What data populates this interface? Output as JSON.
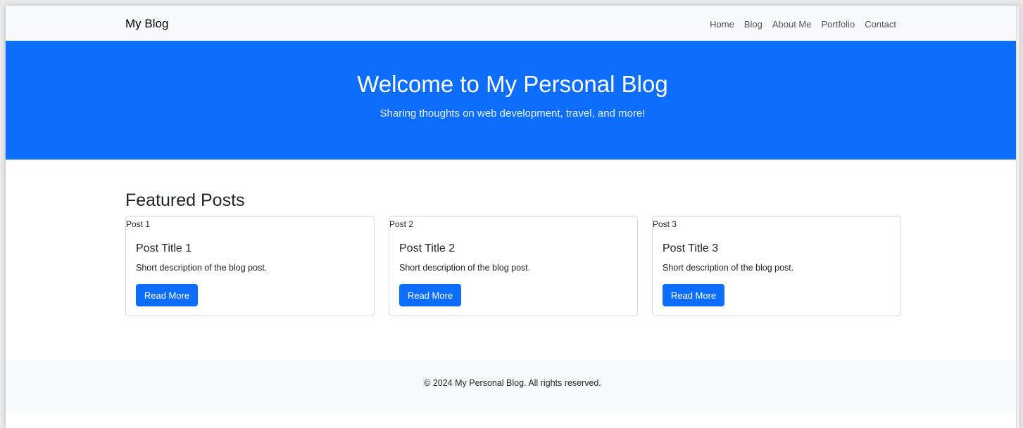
{
  "navbar": {
    "brand": "My Blog",
    "links": [
      "Home",
      "Blog",
      "About Me",
      "Portfolio",
      "Contact"
    ]
  },
  "hero": {
    "title": "Welcome to My Personal Blog",
    "subtitle": "Sharing thoughts on web development, travel, and more!"
  },
  "featured": {
    "heading": "Featured Posts",
    "posts": [
      {
        "image_alt": "Post 1",
        "title": "Post Title 1",
        "description": "Short description of the blog post.",
        "button": "Read More"
      },
      {
        "image_alt": "Post 2",
        "title": "Post Title 2",
        "description": "Short description of the blog post.",
        "button": "Read More"
      },
      {
        "image_alt": "Post 3",
        "title": "Post Title 3",
        "description": "Short description of the blog post.",
        "button": "Read More"
      }
    ]
  },
  "footer": {
    "text": "© 2024 My Personal Blog. All rights reserved."
  },
  "colors": {
    "primary": "#0d6efd",
    "light_bg": "#f8f9fa",
    "text": "#212529"
  }
}
